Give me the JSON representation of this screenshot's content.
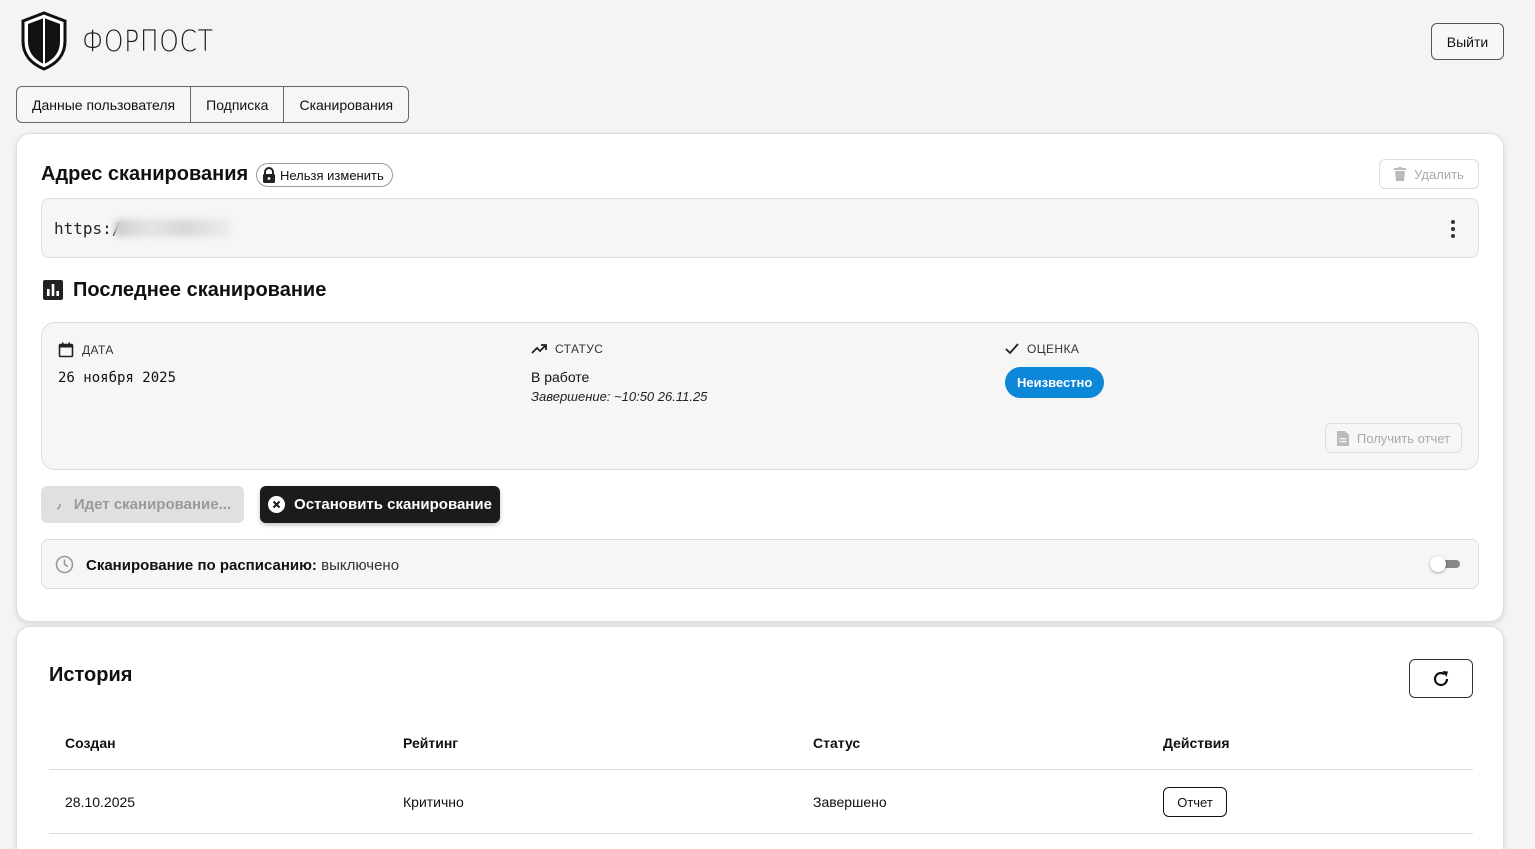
{
  "header": {
    "brand": "ФОРПОСТ",
    "logout_label": "Выйти"
  },
  "tabs": [
    {
      "label": "Данные пользователя"
    },
    {
      "label": "Подписка"
    },
    {
      "label": "Сканирования"
    }
  ],
  "address": {
    "title": "Адрес сканирования",
    "lock_badge": "Нельзя изменить",
    "delete_label": "Удалить",
    "url_visible": "https:/"
  },
  "last_scan": {
    "title": "Последнее сканирование",
    "date_label": "ДАТА",
    "date_value": "26 ноября 2025",
    "status_label": "СТАТУС",
    "status_value": "В работе",
    "status_sub": "Завершение: ~10:50 26.11.25",
    "grade_label": "ОЦЕНКА",
    "grade_value": "Неизвестно",
    "report_label": "Получить отчет"
  },
  "actions": {
    "scanning_label": "Идет сканирование...",
    "stop_label": "Остановить сканирование"
  },
  "schedule": {
    "label": "Сканирование по расписанию:",
    "value": "выключено",
    "enabled": false
  },
  "history": {
    "title": "История",
    "columns": [
      "Создан",
      "Рейтинг",
      "Статус",
      "Действия"
    ],
    "rows": [
      {
        "created": "28.10.2025",
        "rating": "Критично",
        "status": "Завершено",
        "action": "Отчет"
      }
    ]
  },
  "colors": {
    "grade_badge": "#0d87d8",
    "stop_button": "#1b1b1b",
    "background": "#f4f4f4"
  }
}
